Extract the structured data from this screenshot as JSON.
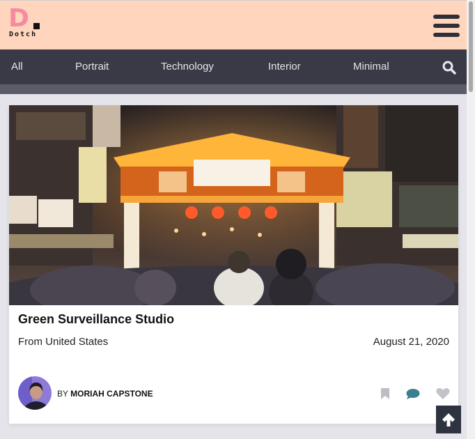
{
  "brand": {
    "letter": "D",
    "name": "Dotch"
  },
  "nav": {
    "items": [
      "All",
      "Portrait",
      "Technology",
      "Interior",
      "Minimal"
    ]
  },
  "card": {
    "title": "Green Surveillance Studio",
    "origin": "From United States",
    "date": "August 21, 2020",
    "by_prefix": "BY",
    "author": "MORIAH CAPSTONE",
    "action_icons": [
      "bookmark-icon",
      "comment-icon",
      "heart-icon"
    ]
  },
  "colors": {
    "header_bg": "#ffd5bd",
    "nav_bg": "#3a3a46",
    "logo_pink": "#f48b9f",
    "comment_accent": "#3c7f92"
  }
}
